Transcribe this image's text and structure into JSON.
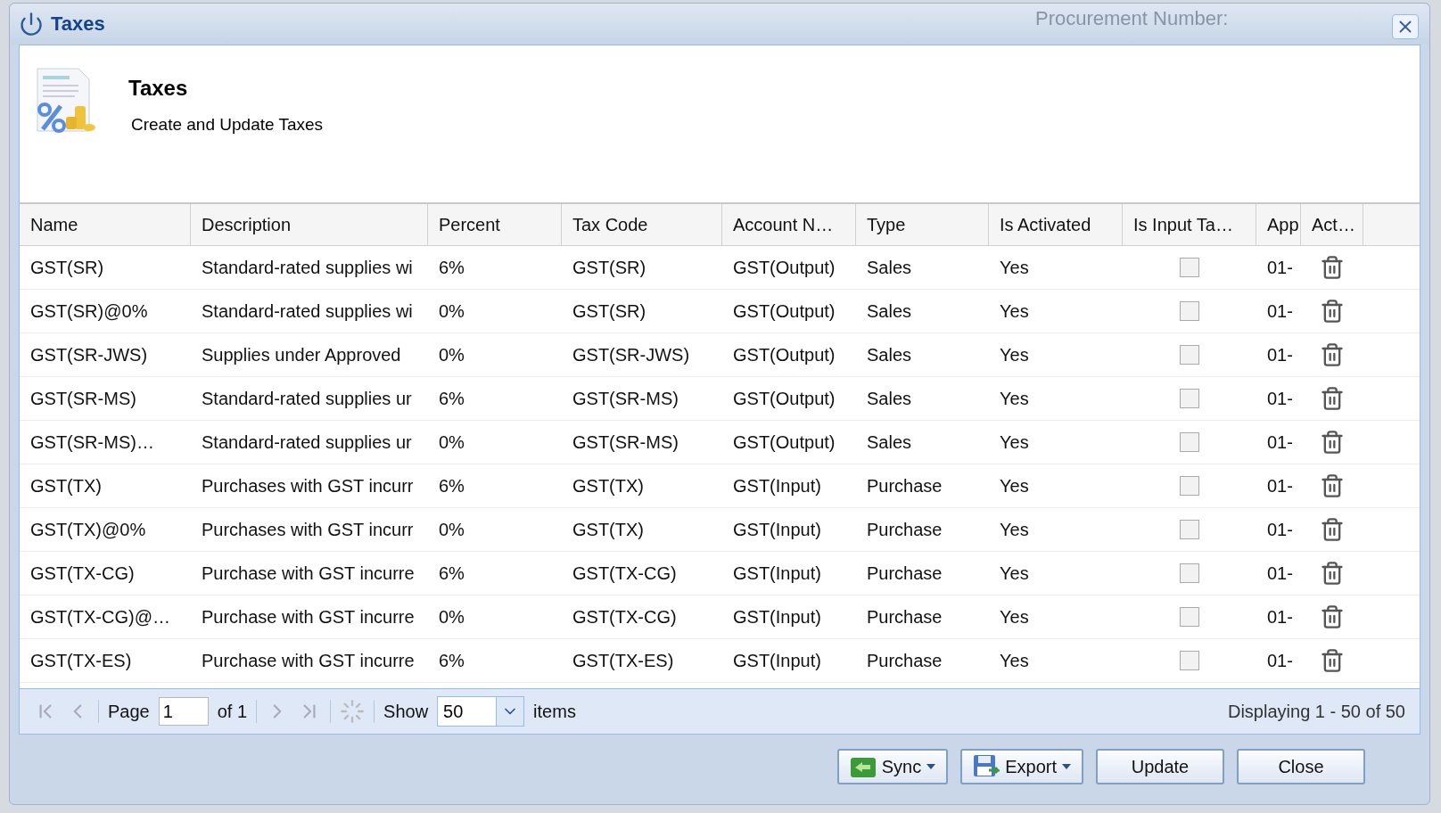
{
  "window": {
    "title": "Taxes",
    "background_label": "Procurement Number:"
  },
  "header": {
    "title": "Taxes",
    "subtitle": "Create and Update Taxes"
  },
  "table": {
    "columns": [
      "Name",
      "Description",
      "Percent",
      "Tax Code",
      "Account N…",
      "Type",
      "Is Activated",
      "Is Input Ta…",
      "App",
      "Act…"
    ],
    "rows": [
      {
        "name": "GST(SR)",
        "description": "Standard-rated supplies wi",
        "percent": "6%",
        "tax_code": "GST(SR)",
        "account": "GST(Output)",
        "type": "Sales",
        "activated": "Yes",
        "input_tax": false,
        "app": "01-"
      },
      {
        "name": "GST(SR)@0%",
        "description": "Standard-rated supplies wi",
        "percent": "0%",
        "tax_code": "GST(SR)",
        "account": "GST(Output)",
        "type": "Sales",
        "activated": "Yes",
        "input_tax": false,
        "app": "01-"
      },
      {
        "name": "GST(SR-JWS)",
        "description": "Supplies under Approved",
        "percent": "0%",
        "tax_code": "GST(SR-JWS)",
        "account": "GST(Output)",
        "type": "Sales",
        "activated": "Yes",
        "input_tax": false,
        "app": "01-"
      },
      {
        "name": "GST(SR-MS)",
        "description": "Standard-rated supplies ur",
        "percent": "6%",
        "tax_code": "GST(SR-MS)",
        "account": "GST(Output)",
        "type": "Sales",
        "activated": "Yes",
        "input_tax": false,
        "app": "01-"
      },
      {
        "name": "GST(SR-MS)…",
        "description": "Standard-rated supplies ur",
        "percent": "0%",
        "tax_code": "GST(SR-MS)",
        "account": "GST(Output)",
        "type": "Sales",
        "activated": "Yes",
        "input_tax": false,
        "app": "01-"
      },
      {
        "name": "GST(TX)",
        "description": "Purchases with GST incurr",
        "percent": "6%",
        "tax_code": "GST(TX)",
        "account": "GST(Input)",
        "type": "Purchase",
        "activated": "Yes",
        "input_tax": false,
        "app": "01-"
      },
      {
        "name": "GST(TX)@0%",
        "description": "Purchases with GST incurr",
        "percent": "0%",
        "tax_code": "GST(TX)",
        "account": "GST(Input)",
        "type": "Purchase",
        "activated": "Yes",
        "input_tax": false,
        "app": "01-"
      },
      {
        "name": "GST(TX-CG)",
        "description": "Purchase with GST incurre",
        "percent": "6%",
        "tax_code": "GST(TX-CG)",
        "account": "GST(Input)",
        "type": "Purchase",
        "activated": "Yes",
        "input_tax": false,
        "app": "01-"
      },
      {
        "name": "GST(TX-CG)@…",
        "description": "Purchase with GST incurre",
        "percent": "0%",
        "tax_code": "GST(TX-CG)",
        "account": "GST(Input)",
        "type": "Purchase",
        "activated": "Yes",
        "input_tax": false,
        "app": "01-"
      },
      {
        "name": "GST(TX-ES)",
        "description": "Purchase with GST incurre",
        "percent": "6%",
        "tax_code": "GST(TX-ES)",
        "account": "GST(Input)",
        "type": "Purchase",
        "activated": "Yes",
        "input_tax": false,
        "app": "01-"
      }
    ]
  },
  "pager": {
    "page_label": "Page",
    "page": "1",
    "of": "of 1",
    "show_label": "Show",
    "page_size": "50",
    "items_label": "items",
    "summary": "Displaying 1 - 50 of 50"
  },
  "buttons": [
    {
      "label": "Sync",
      "kind": "menu"
    },
    {
      "label": "Export",
      "kind": "menu"
    },
    {
      "label": "Update",
      "kind": "plain"
    },
    {
      "label": "Close",
      "kind": "plain"
    }
  ]
}
